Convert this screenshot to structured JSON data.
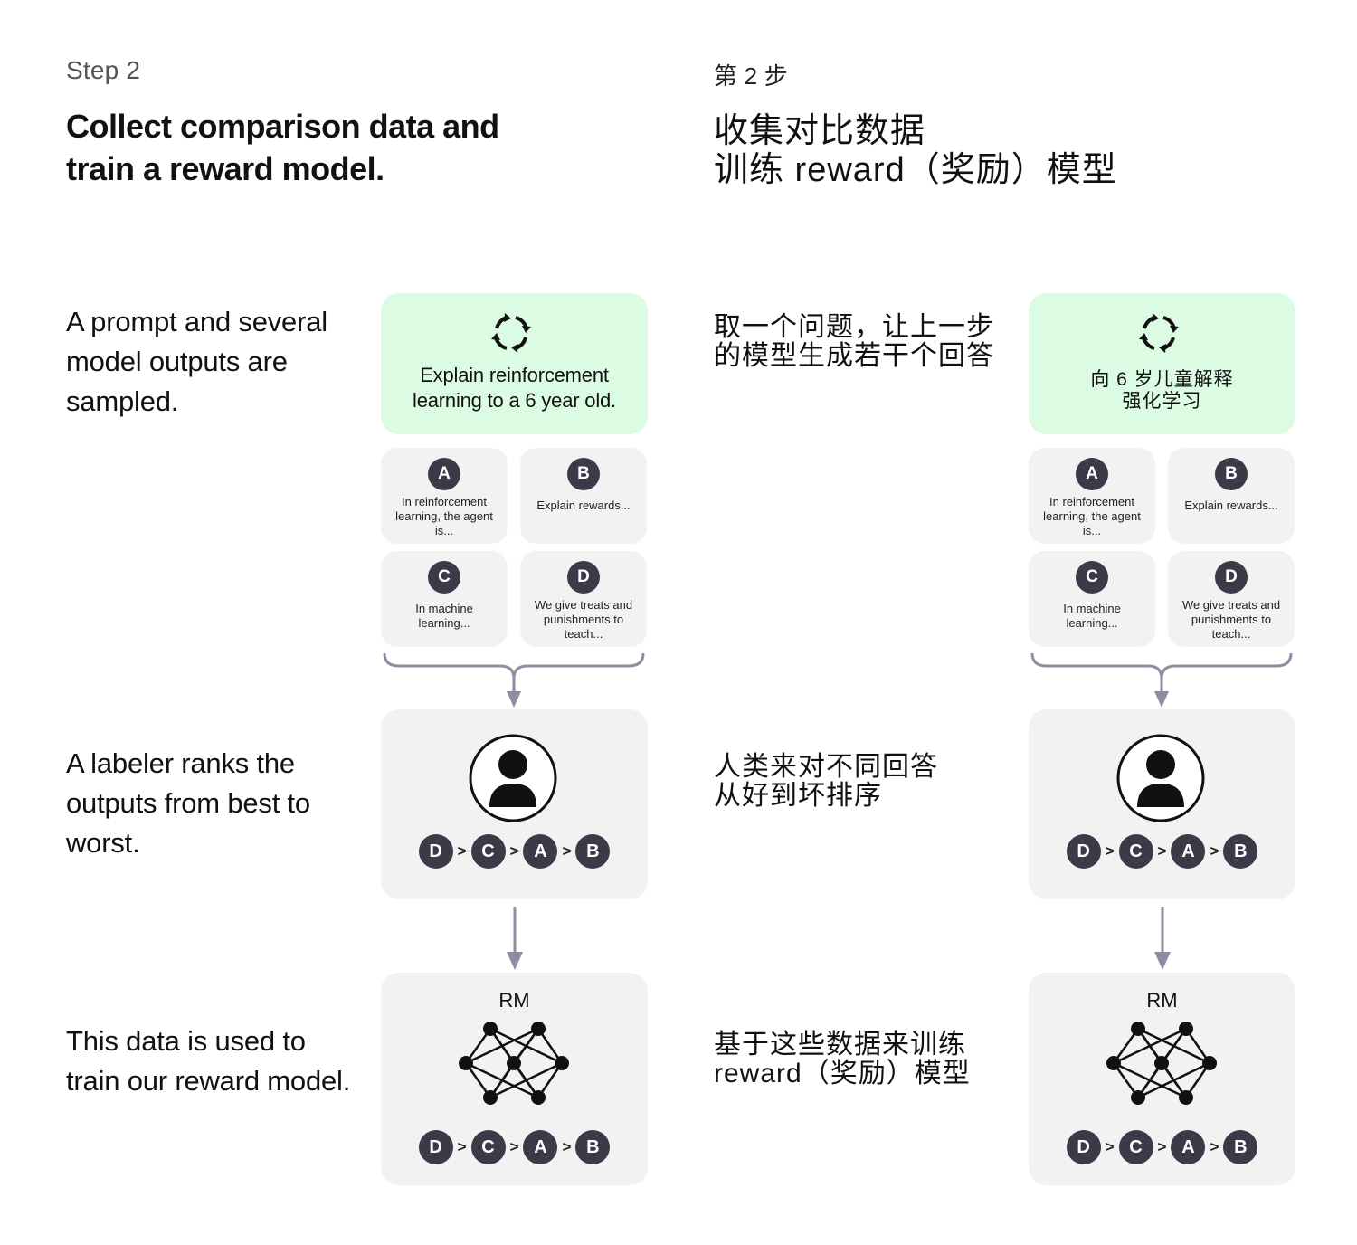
{
  "english": {
    "step": "Step 2",
    "title": "Collect comparison data and train a reward model.",
    "desc_sample": "A prompt and several model outputs are sampled.",
    "desc_rank": "A labeler ranks the outputs from best to worst.",
    "desc_train": "This data is used to train our reward model.",
    "prompt": "Explain reinforcement learning to a 6 year old.",
    "options": [
      {
        "letter": "A",
        "text": "In reinforcement learning, the agent is..."
      },
      {
        "letter": "B",
        "text": "Explain rewards..."
      },
      {
        "letter": "C",
        "text": "In machine learning..."
      },
      {
        "letter": "D",
        "text": "We give treats and punishments to teach..."
      }
    ],
    "rm_label": "RM"
  },
  "chinese": {
    "step": "第 2 步",
    "title": "收集对比数据\n训练 reward（奖励）模型",
    "desc_sample": "取一个问题，让上一步\n的模型生成若干个回答",
    "desc_rank": "人类来对不同回答\n从好到坏排序",
    "desc_train": "基于这些数据来训练\nreward（奖励）模型",
    "prompt": "向 6 岁儿童解释\n强化学习",
    "options": [
      {
        "letter": "A",
        "text": "In reinforcement learning, the agent is..."
      },
      {
        "letter": "B",
        "text": "Explain rewards..."
      },
      {
        "letter": "C",
        "text": "In machine learning..."
      },
      {
        "letter": "D",
        "text": "We give treats and punishments to teach..."
      }
    ],
    "rm_label": "RM"
  },
  "ranking": [
    "D",
    "C",
    "A",
    "B"
  ],
  "ranking_separator": ">",
  "colors": {
    "prompt_bg": "#dbfbe3",
    "card_bg": "#f2f2f2",
    "badge_bg": "#3a3a48",
    "arrow": "#8e8ea3"
  }
}
